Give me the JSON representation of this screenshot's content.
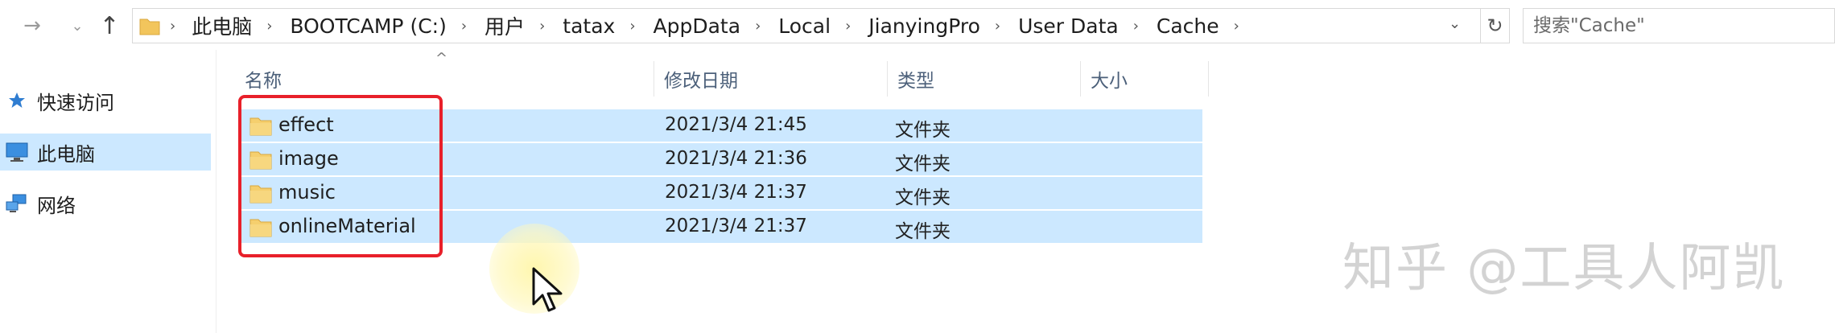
{
  "navbar": {
    "breadcrumbs": [
      "此电脑",
      "BOOTCAMP (C:)",
      "用户",
      "tatax",
      "AppData",
      "Local",
      "JianyingPro",
      "User Data",
      "Cache"
    ],
    "search_placeholder": "搜索\"Cache\""
  },
  "sidebar": {
    "items": [
      {
        "label": "快速访问",
        "icon": "star-icon",
        "selected": false
      },
      {
        "label": "此电脑",
        "icon": "computer-icon",
        "selected": true
      },
      {
        "label": "网络",
        "icon": "network-icon",
        "selected": false
      }
    ]
  },
  "file_list": {
    "columns": {
      "name": "名称",
      "date": "修改日期",
      "type": "类型",
      "size": "大小"
    },
    "rows": [
      {
        "name": "effect",
        "date": "2021/3/4 21:45",
        "type": "文件夹",
        "size": ""
      },
      {
        "name": "image",
        "date": "2021/3/4 21:36",
        "type": "文件夹",
        "size": ""
      },
      {
        "name": "music",
        "date": "2021/3/4 21:37",
        "type": "文件夹",
        "size": ""
      },
      {
        "name": "onlineMaterial",
        "date": "2021/3/4 21:37",
        "type": "文件夹",
        "size": ""
      }
    ]
  },
  "watermark": "知乎 @工具人阿凯",
  "colors": {
    "selection": "#cce8ff",
    "highlight_box": "#e8202a",
    "folder": "#f2c55c"
  }
}
